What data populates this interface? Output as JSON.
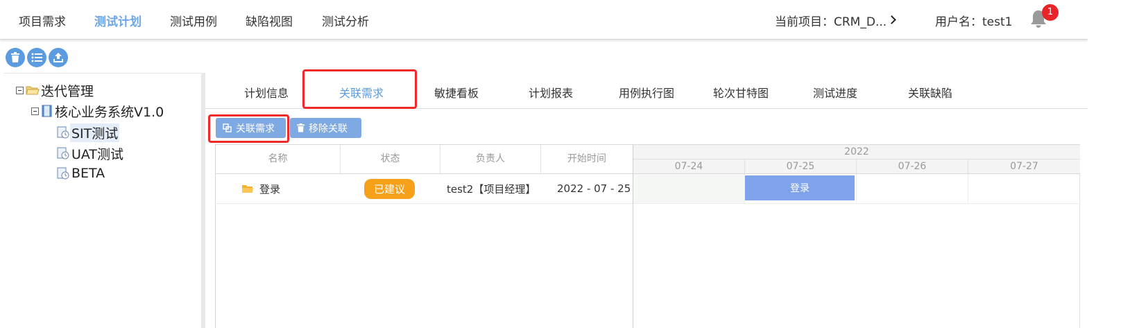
{
  "nav": {
    "items": [
      "项目需求",
      "测试计划",
      "测试用例",
      "缺陷视图",
      "测试分析"
    ],
    "active_index": 1,
    "project_label": "当前项目：CRM_D...",
    "username_label": "用户名：test1",
    "notification_count": "1"
  },
  "toolbar": {
    "icons": [
      "trash-icon",
      "list-icon",
      "upload-icon"
    ]
  },
  "tree": {
    "root": "迭代管理",
    "system": "核心业务系统V1.0",
    "children": [
      "SIT测试",
      "UAT测试",
      "BETA"
    ],
    "selected_index": 0
  },
  "tabs": {
    "items": [
      "计划信息",
      "关联需求",
      "敏捷看板",
      "计划报表",
      "用例执行图",
      "轮次甘特图",
      "测试进度",
      "关联缺陷"
    ],
    "active_index": 1
  },
  "actions": {
    "link_label": "关联需求",
    "unlink_label": "移除关联"
  },
  "grid": {
    "headers": [
      "名称",
      "状态",
      "负责人",
      "开始时间"
    ],
    "rows": [
      {
        "name": "登录",
        "status": "已建议",
        "owner": "test2【项目经理】",
        "start": "2022 - 07 - 25"
      }
    ]
  },
  "gantt": {
    "year": "2022",
    "days": [
      "07-24",
      "07-25",
      "07-26",
      "07-27"
    ],
    "bar_label": "登录"
  },
  "colors": {
    "accent": "#5b9be0",
    "highlight": "#ee2a2a",
    "status": "#f7a11a",
    "bar": "#7fa3ea"
  }
}
